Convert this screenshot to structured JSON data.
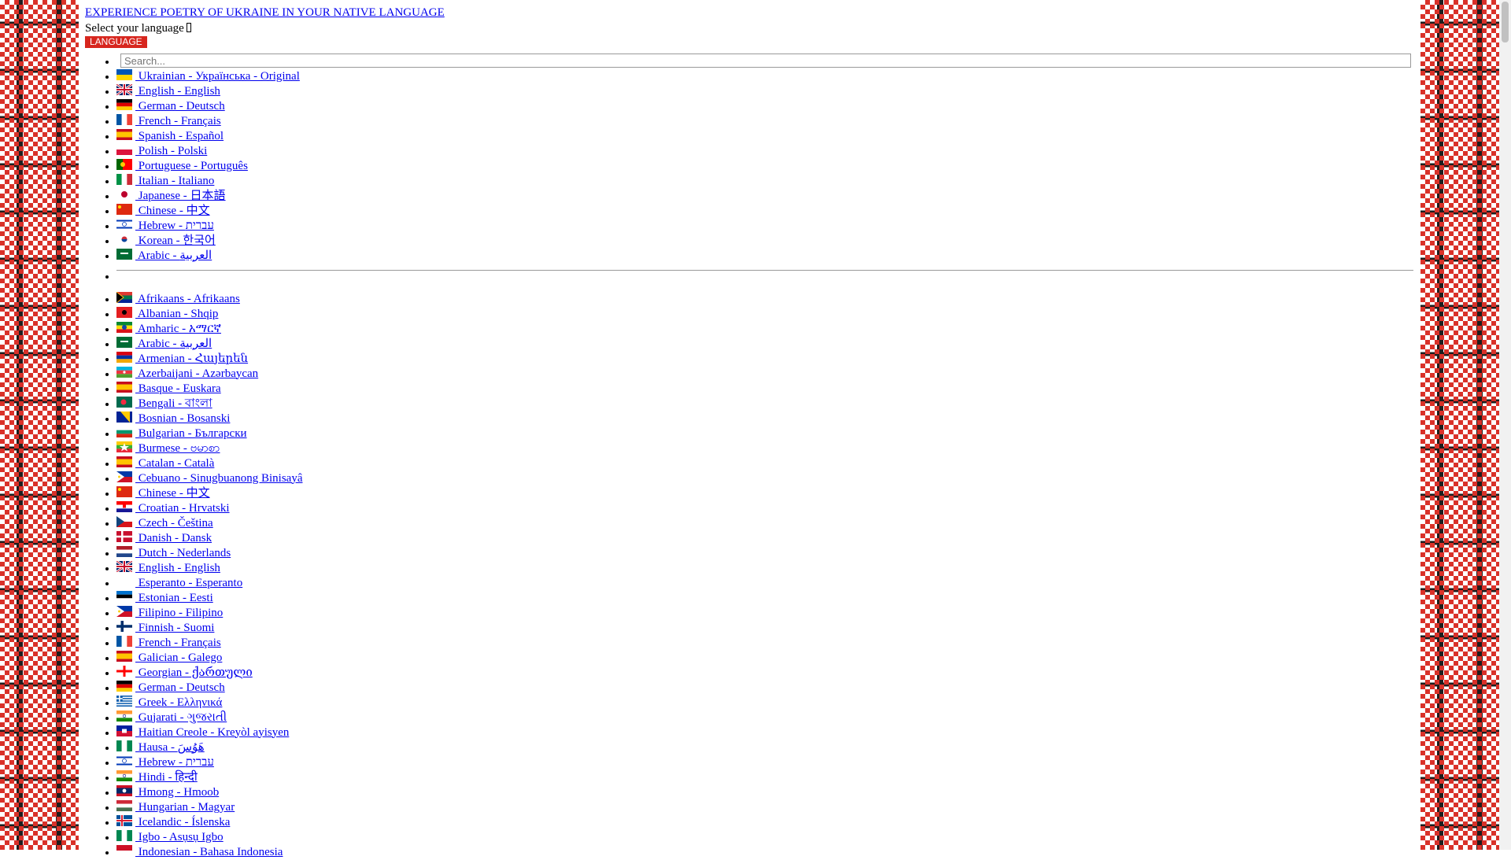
{
  "header": {
    "title": "EXPERIENCE POETRY OF UKRAINE IN YOUR NATIVE LANGUAGE",
    "select_label": "Select your language",
    "language_button": "LANGUAGE"
  },
  "search": {
    "placeholder": "Search..."
  },
  "featured": [
    {
      "label": " Ukrainian - Українська - Original",
      "flag": "ua"
    },
    {
      "label": " English - English",
      "flag": "gb"
    },
    {
      "label": " German - Deutsch",
      "flag": "de"
    },
    {
      "label": " French - Français",
      "flag": "fr"
    },
    {
      "label": " Spanish - Español",
      "flag": "es"
    },
    {
      "label": " Polish - Polski",
      "flag": "pl"
    },
    {
      "label": " Portuguese - Português",
      "flag": "pt"
    },
    {
      "label": " Italian - Italiano",
      "flag": "it"
    },
    {
      "label": " Japanese - 日本語",
      "flag": "jp"
    },
    {
      "label": " Chinese - 中文",
      "flag": "cn"
    },
    {
      "label": " Hebrew - עברית",
      "flag": "il"
    },
    {
      "label": " Korean - 한국어",
      "flag": "kr"
    },
    {
      "label": " Arabic - العربية",
      "flag": "sa"
    }
  ],
  "all": [
    {
      "label": " Afrikaans - Afrikaans",
      "flag": "za"
    },
    {
      "label": " Albanian - Shqip",
      "flag": "al"
    },
    {
      "label": " Amharic - አማርኛ",
      "flag": "et"
    },
    {
      "label": " Arabic - العربية",
      "flag": "sa"
    },
    {
      "label": " Armenian - Հայերեն",
      "flag": "am"
    },
    {
      "label": " Azerbaijani - Azərbaycan",
      "flag": "az"
    },
    {
      "label": " Basque - Euskara",
      "flag": "es"
    },
    {
      "label": " Bengali - বাংলা",
      "flag": "bd"
    },
    {
      "label": " Bosnian - Bosanski",
      "flag": "ba"
    },
    {
      "label": " Bulgarian - Български",
      "flag": "bg"
    },
    {
      "label": " Burmese - ဗမာစာ",
      "flag": "mm"
    },
    {
      "label": " Catalan - Català",
      "flag": "es"
    },
    {
      "label": " Cebuano - Sinugbuanong Binisayâ",
      "flag": "ph"
    },
    {
      "label": " Chinese - 中文",
      "flag": "cn"
    },
    {
      "label": " Croatian - Hrvatski",
      "flag": "hr"
    },
    {
      "label": " Czech - Čeština",
      "flag": "cz"
    },
    {
      "label": " Danish - Dansk",
      "flag": "dk"
    },
    {
      "label": " Dutch - Nederlands",
      "flag": "nl"
    },
    {
      "label": " English - English",
      "flag": "gb"
    },
    {
      "label": " Esperanto - Esperanto",
      "flag": "none"
    },
    {
      "label": " Estonian - Eesti",
      "flag": "ee"
    },
    {
      "label": " Filipino - Filipino",
      "flag": "ph"
    },
    {
      "label": " Finnish - Suomi",
      "flag": "fi"
    },
    {
      "label": " French - Français",
      "flag": "fr"
    },
    {
      "label": " Galician - Galego",
      "flag": "es"
    },
    {
      "label": " Georgian - ქართული",
      "flag": "ge"
    },
    {
      "label": " German - Deutsch",
      "flag": "de"
    },
    {
      "label": " Greek - Ελληνικά",
      "flag": "gr"
    },
    {
      "label": " Gujarati - ગુજરાતી",
      "flag": "in"
    },
    {
      "label": " Haitian Creole - Kreyòl ayisyen",
      "flag": "ht"
    },
    {
      "label": " Hausa - هَوُسَ",
      "flag": "ng"
    },
    {
      "label": " Hebrew - עברית",
      "flag": "il"
    },
    {
      "label": " Hindi - हिन्दी",
      "flag": "in"
    },
    {
      "label": " Hmong - Hmoob",
      "flag": "la"
    },
    {
      "label": " Hungarian - Magyar",
      "flag": "hu"
    },
    {
      "label": " Icelandic - Íslenska",
      "flag": "is"
    },
    {
      "label": " Igbo - Asụsụ Igbo",
      "flag": "ng"
    },
    {
      "label": " Indonesian - Bahasa Indonesia",
      "flag": "id"
    }
  ],
  "colors": {
    "link": "#0000ee",
    "accent": "#d7261e"
  }
}
